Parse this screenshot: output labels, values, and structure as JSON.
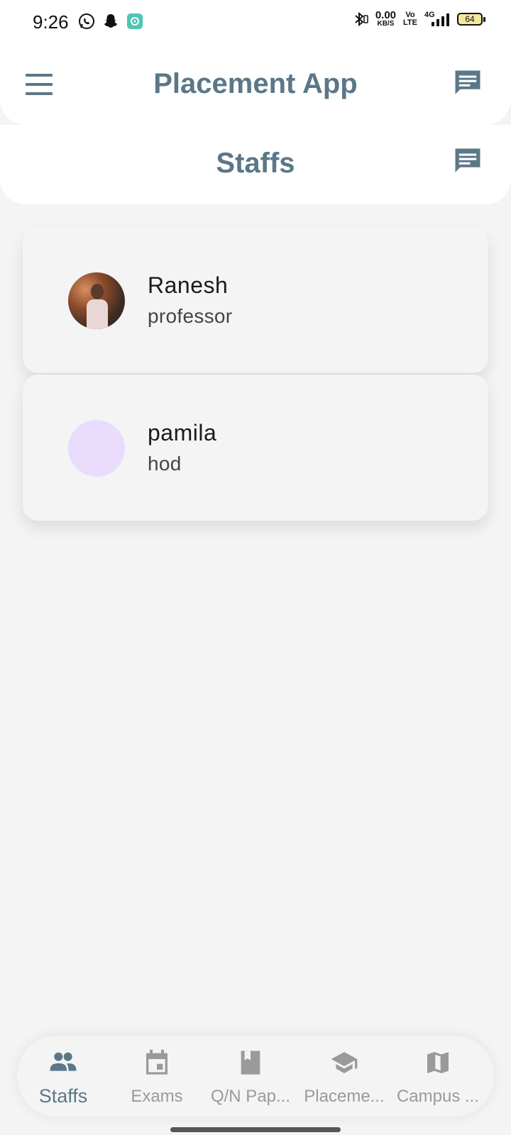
{
  "status_bar": {
    "time": "9:26",
    "net_speed_value": "0.00",
    "net_speed_unit": "KB/S",
    "volte_top": "Vo",
    "volte_bottom": "LTE",
    "network": "4G",
    "battery": "64"
  },
  "app_bar": {
    "title": "Placement App"
  },
  "section": {
    "title": "Staffs"
  },
  "staff": [
    {
      "name": "Ranesh",
      "role": "professor"
    },
    {
      "name": "pamila",
      "role": "hod"
    }
  ],
  "bottom_nav": {
    "items": [
      {
        "label": "Staffs",
        "icon": "people-icon",
        "active": true
      },
      {
        "label": "Exams",
        "icon": "calendar-icon",
        "active": false
      },
      {
        "label": "Q/N Pap...",
        "icon": "book-icon",
        "active": false
      },
      {
        "label": "Placeme...",
        "icon": "graduation-cap-icon",
        "active": false
      },
      {
        "label": "Campus ...",
        "icon": "map-icon",
        "active": false
      }
    ]
  },
  "colors": {
    "accent": "#5b7788",
    "background": "#f4f4f4",
    "inactive": "#9a9a9a",
    "avatar_placeholder": "#eadcfd"
  }
}
